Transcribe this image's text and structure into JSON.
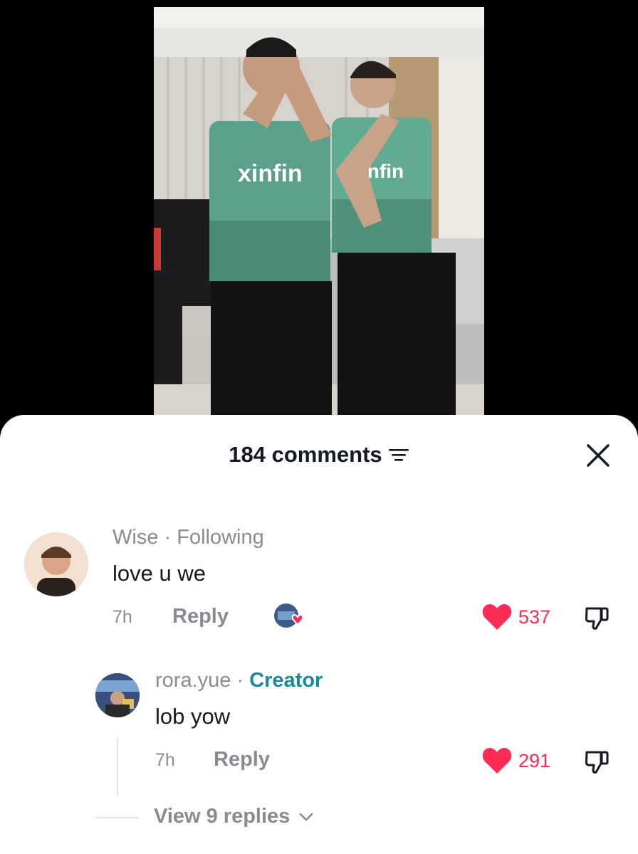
{
  "header": {
    "comments_count": "184 comments"
  },
  "comments": [
    {
      "author": "Wise",
      "relation": "Following",
      "text": "love u we",
      "time": "7h",
      "reply_label": "Reply",
      "likes": "537"
    },
    {
      "author": "rora.yue",
      "relation": "Creator",
      "text": "lob yow",
      "time": "7h",
      "reply_label": "Reply",
      "likes": "291"
    }
  ],
  "view_replies": "View 9 replies",
  "colors": {
    "like": "#fe2c55",
    "creator_badge": "#1a8a99",
    "muted": "#8a8b91",
    "text": "#161823"
  },
  "icons": {
    "filter": "filter-icon",
    "close": "close-icon",
    "like": "heart-icon",
    "dislike": "thumbs-down-icon",
    "creator_liked": "creator-liked-icon",
    "chevron": "chevron-down-icon"
  }
}
